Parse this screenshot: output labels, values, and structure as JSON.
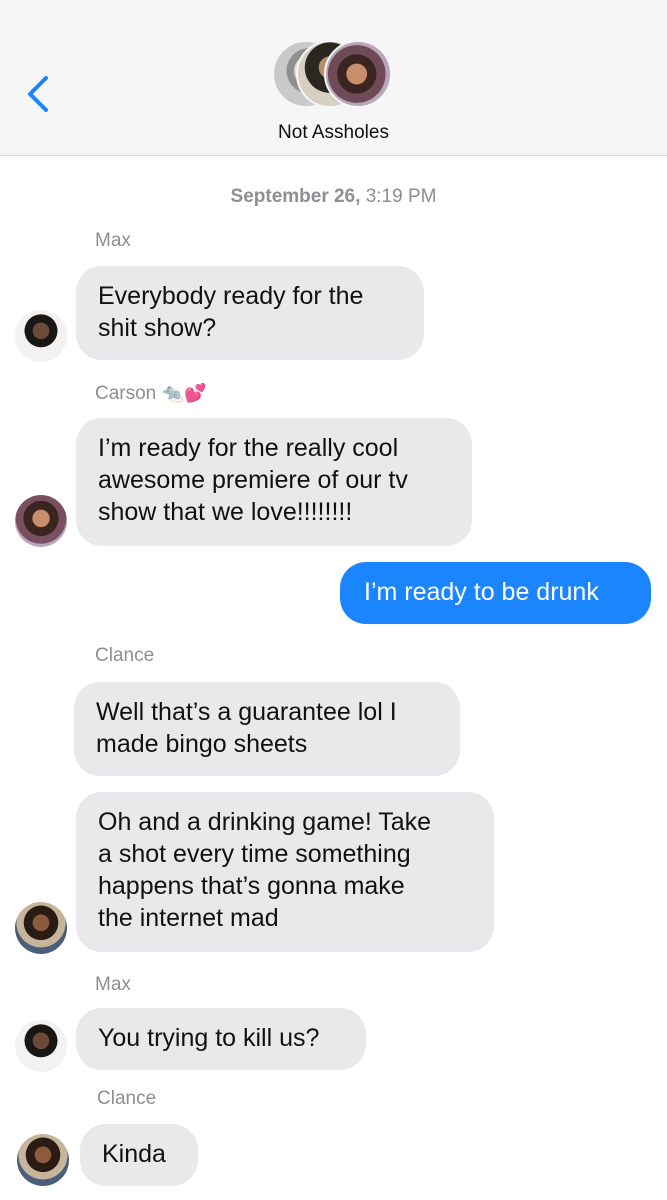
{
  "header": {
    "group_name": "Not Assholes",
    "back_icon": "chevron-left-icon",
    "accent_color": "#1a85ff"
  },
  "timestamp": {
    "date": "September 26,",
    "time": " 3:19 PM"
  },
  "messages": [
    {
      "sender": "Max",
      "text_lines": [
        "Everybody ready for the",
        "shit show?"
      ],
      "direction": "incoming"
    },
    {
      "sender": "Carson",
      "sender_emoji": [
        "rat-emoji",
        "two-hearts-emoji"
      ],
      "text_lines": [
        "I’m ready for the really cool",
        "awesome premiere of our tv",
        "show that we love!!!!!!!!"
      ],
      "direction": "incoming"
    },
    {
      "text_lines": [
        "I’m ready to be drunk"
      ],
      "direction": "outgoing"
    },
    {
      "sender": "Clance",
      "text_lines": [
        "Well that’s a guarantee lol I",
        "made bingo sheets"
      ],
      "direction": "incoming"
    },
    {
      "text_lines": [
        "Oh and a drinking game! Take",
        "a shot every time something",
        "happens that’s gonna make",
        "the internet mad"
      ],
      "direction": "incoming"
    },
    {
      "sender": "Max",
      "text_lines": [
        "You trying to kill us?"
      ],
      "direction": "incoming"
    },
    {
      "sender": "Clance",
      "text_lines": [
        "Kinda"
      ],
      "direction": "incoming"
    }
  ]
}
